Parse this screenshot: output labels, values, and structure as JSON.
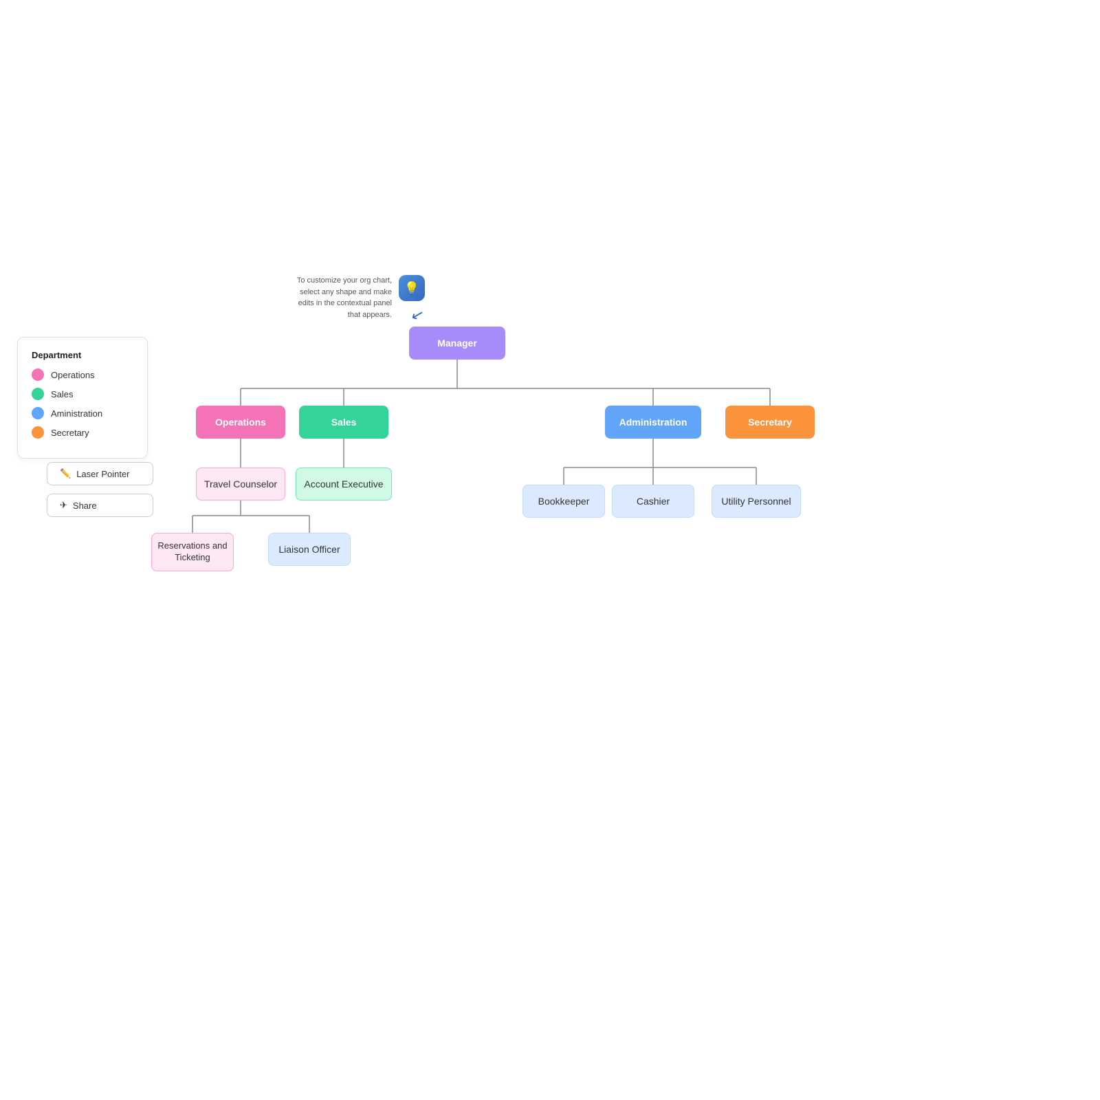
{
  "legend": {
    "title": "Department",
    "items": [
      {
        "label": "Operations",
        "color": "#f472b6"
      },
      {
        "label": "Sales",
        "color": "#34d399"
      },
      {
        "label": "Aministration",
        "color": "#60a5fa"
      },
      {
        "label": "Secretary",
        "color": "#fb923c"
      }
    ]
  },
  "buttons": {
    "laser_pointer": "Laser Pointer",
    "share": "Share"
  },
  "tooltip": {
    "text": "To customize your org chart, select any shape and make edits in the contextual panel that appears."
  },
  "nodes": {
    "manager": "Manager",
    "operations": "Operations",
    "sales": "Sales",
    "administration": "Administration",
    "secretary_top": "Secretary",
    "travel_counselor": "Travel Counselor",
    "account_executive": "Account Executive",
    "bookkeeper": "Bookkeeper",
    "cashier": "Cashier",
    "utility_personnel": "Utility Personnel",
    "reservations_ticketing": "Reservations and Ticketing",
    "liaison_officer": "Liaison Officer"
  }
}
